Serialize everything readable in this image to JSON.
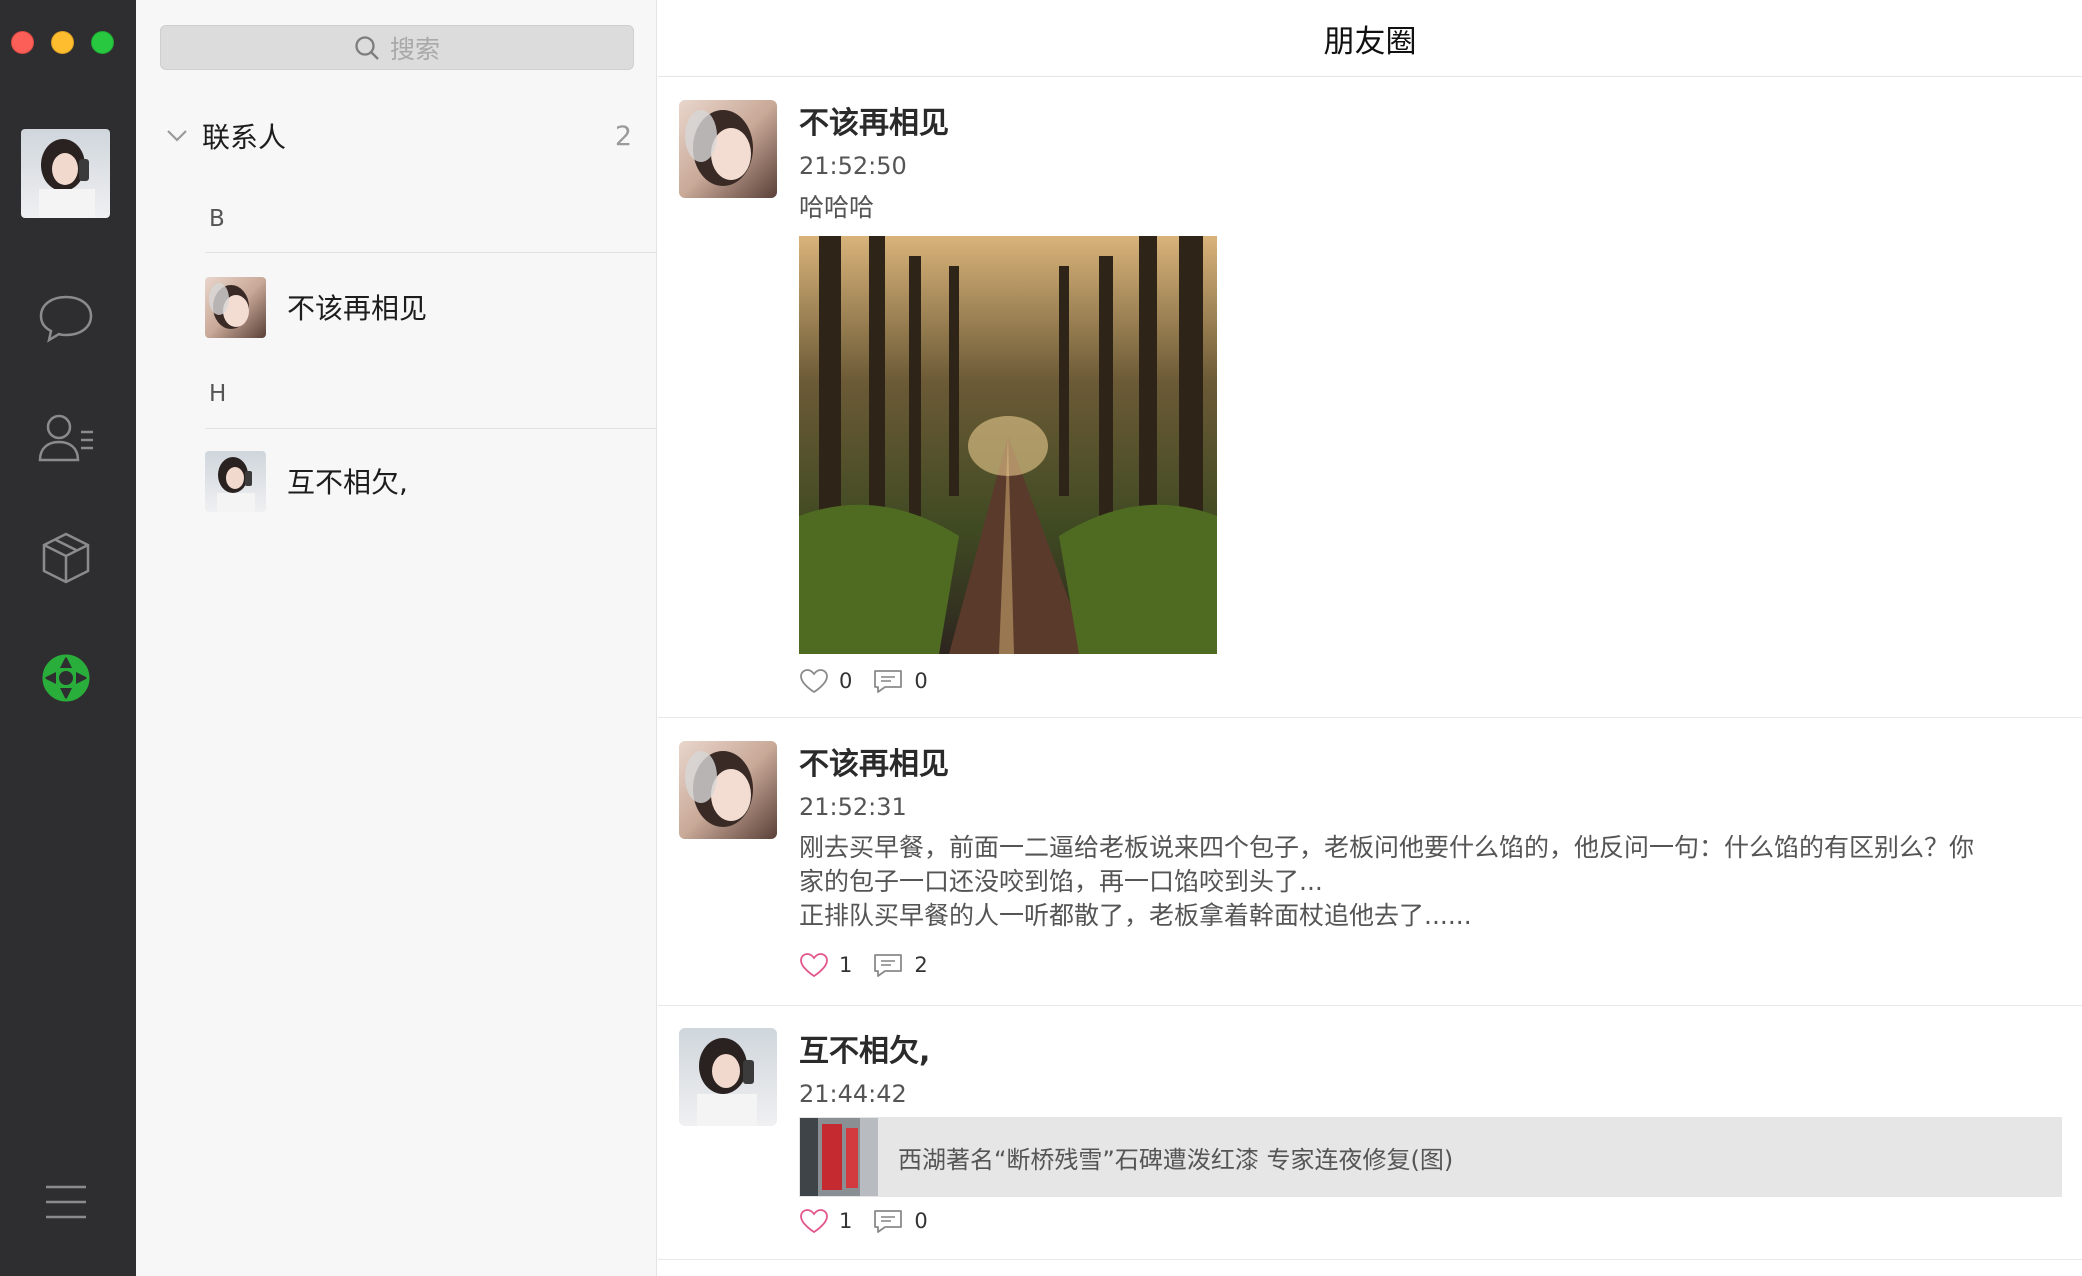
{
  "window": {
    "title": "朋友圈"
  },
  "sidebar": {
    "icons": [
      "chat-icon",
      "contacts-icon",
      "box-icon",
      "moments-icon",
      "menu-icon"
    ],
    "accent": "#2aae3b"
  },
  "contacts": {
    "search_placeholder": "搜索",
    "group_label": "联系人",
    "group_count": "2",
    "sections": [
      {
        "letter": "B",
        "name": "不该再相见"
      },
      {
        "letter": "H",
        "name": "互不相欠,"
      }
    ]
  },
  "moments": {
    "posts": [
      {
        "author": "不该再相见",
        "time": "21:52:50",
        "text": "哈哈哈",
        "likes": "0",
        "comments": "0",
        "liked": false
      },
      {
        "author": "不该再相见",
        "time": "21:52:31",
        "text_lines": [
          "刚去买早餐，前面一二逼给老板说来四个包子，老板问他要什么馅的，他反问一句：什么馅的有区别么？你",
          "家的包子一口还没咬到馅，再一口馅咬到头了...",
          "正排队买早餐的人一听都散了，老板拿着幹面杖追他去了......"
        ],
        "likes": "1",
        "comments": "2",
        "liked": true
      },
      {
        "author": "互不相欠,",
        "time": "21:44:42",
        "link_title": "西湖著名“断桥残雪”石碑遭泼红漆 专家连夜修复(图)",
        "likes": "1",
        "comments": "0",
        "liked": true
      }
    ]
  }
}
